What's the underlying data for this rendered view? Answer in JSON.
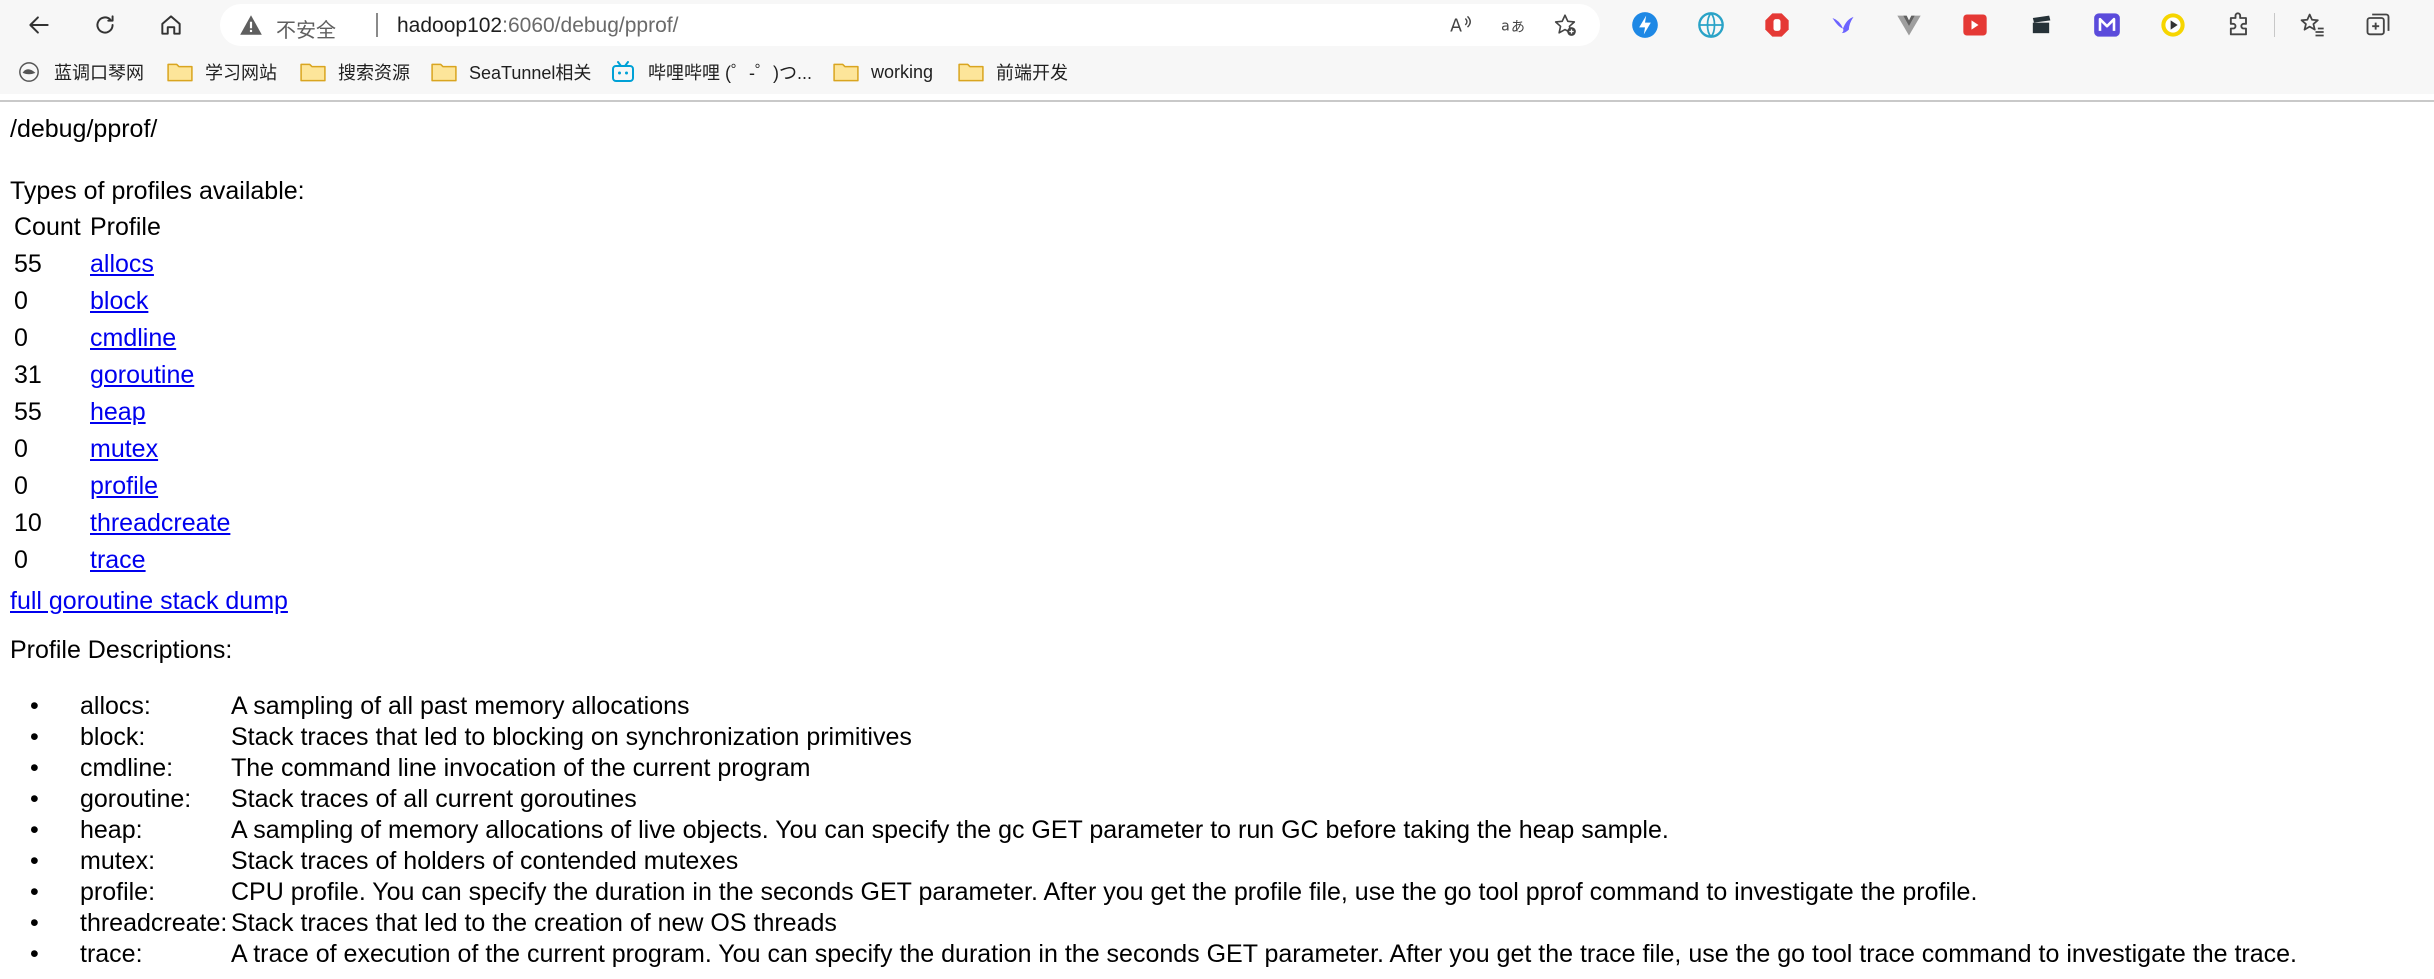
{
  "browser": {
    "omnibox": {
      "security_label": "不安全",
      "url_host": "hadoop102",
      "url_rest": ":6060/debug/pprof/"
    },
    "bookmarks": [
      {
        "label": "蓝调口琴网",
        "icon": "site-logo-icon"
      },
      {
        "label": "学习网站",
        "icon": "folder-icon"
      },
      {
        "label": "搜索资源",
        "icon": "folder-icon"
      },
      {
        "label": "SeaTunnel相关",
        "icon": "folder-icon"
      },
      {
        "label": "哔哩哔哩 (゜-゜)つ...",
        "icon": "bilibili-icon"
      },
      {
        "label": "working",
        "icon": "folder-icon"
      },
      {
        "label": "前端开发",
        "icon": "folder-icon"
      }
    ],
    "colors": {
      "chrome_bg": "#f7f7f7",
      "link": "#0000ee",
      "folder": "#f4c64a"
    }
  },
  "page": {
    "heading": "/debug/pprof/",
    "types_heading": "Types of profiles available:",
    "table": {
      "col_count": "Count",
      "col_profile": "Profile",
      "rows": [
        {
          "count": "55",
          "profile": "allocs"
        },
        {
          "count": "0",
          "profile": "block"
        },
        {
          "count": "0",
          "profile": "cmdline"
        },
        {
          "count": "31",
          "profile": "goroutine"
        },
        {
          "count": "55",
          "profile": "heap"
        },
        {
          "count": "0",
          "profile": "mutex"
        },
        {
          "count": "0",
          "profile": "profile"
        },
        {
          "count": "10",
          "profile": "threadcreate"
        },
        {
          "count": "0",
          "profile": "trace"
        }
      ]
    },
    "dump_link": "full goroutine stack dump",
    "desc_heading": "Profile Descriptions:",
    "descriptions": [
      {
        "name": "allocs:",
        "text": "A sampling of all past memory allocations"
      },
      {
        "name": "block:",
        "text": "Stack traces that led to blocking on synchronization primitives"
      },
      {
        "name": "cmdline:",
        "text": "The command line invocation of the current program"
      },
      {
        "name": "goroutine:",
        "text": "Stack traces of all current goroutines"
      },
      {
        "name": "heap:",
        "text": "A sampling of memory allocations of live objects. You can specify the gc GET parameter to run GC before taking the heap sample."
      },
      {
        "name": "mutex:",
        "text": "Stack traces of holders of contended mutexes"
      },
      {
        "name": "profile:",
        "text": "CPU profile. You can specify the duration in the seconds GET parameter. After you get the profile file, use the go tool pprof command to investigate the profile."
      },
      {
        "name": "threadcreate:",
        "text": "Stack traces that led to the creation of new OS threads"
      },
      {
        "name": "trace:",
        "text": "A trace of execution of the current program. You can specify the duration in the seconds GET parameter. After you get the trace file, use the go tool trace command to investigate the trace."
      }
    ]
  }
}
